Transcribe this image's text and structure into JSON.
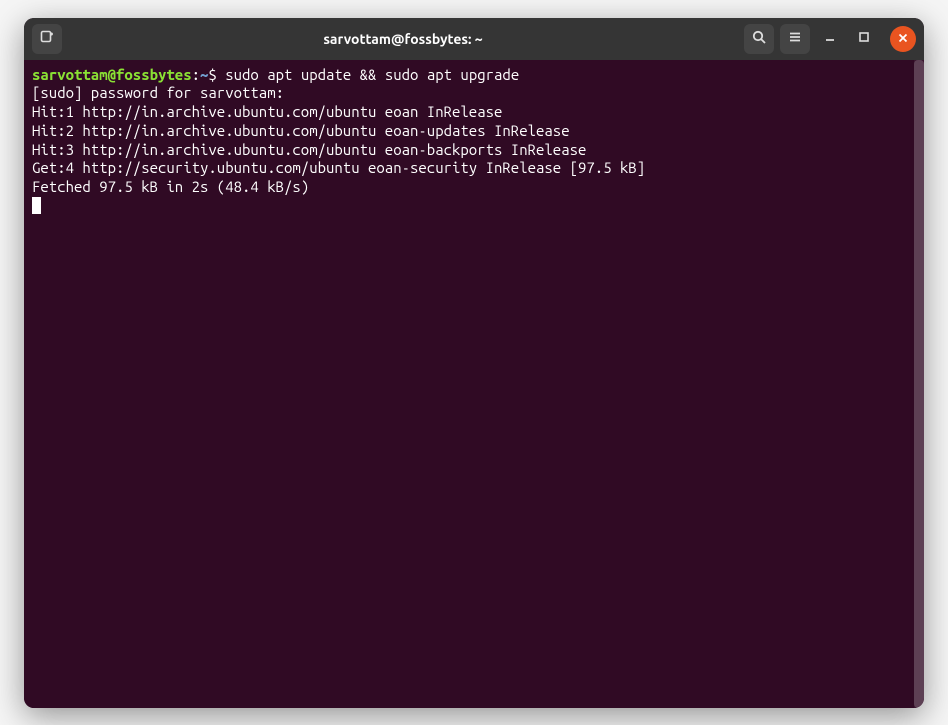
{
  "titlebar": {
    "title": "sarvottam@fossbytes: ~"
  },
  "prompt": {
    "user_host": "sarvottam@fossbytes",
    "separator1": ":",
    "path": "~",
    "separator2": "$ ",
    "command": "sudo apt update && sudo apt upgrade"
  },
  "output": {
    "line1": "[sudo] password for sarvottam:",
    "line2": "Hit:1 http://in.archive.ubuntu.com/ubuntu eoan InRelease",
    "line3": "Hit:2 http://in.archive.ubuntu.com/ubuntu eoan-updates InRelease",
    "line4": "Hit:3 http://in.archive.ubuntu.com/ubuntu eoan-backports InRelease",
    "line5": "Get:4 http://security.ubuntu.com/ubuntu eoan-security InRelease [97.5 kB]",
    "line6": "Fetched 97.5 kB in 2s (48.4 kB/s)"
  },
  "icons": {
    "new_tab": "new-tab-icon",
    "search": "search-icon",
    "menu": "hamburger-icon",
    "minimize": "minimize-icon",
    "maximize": "maximize-icon",
    "close": "close-icon"
  }
}
